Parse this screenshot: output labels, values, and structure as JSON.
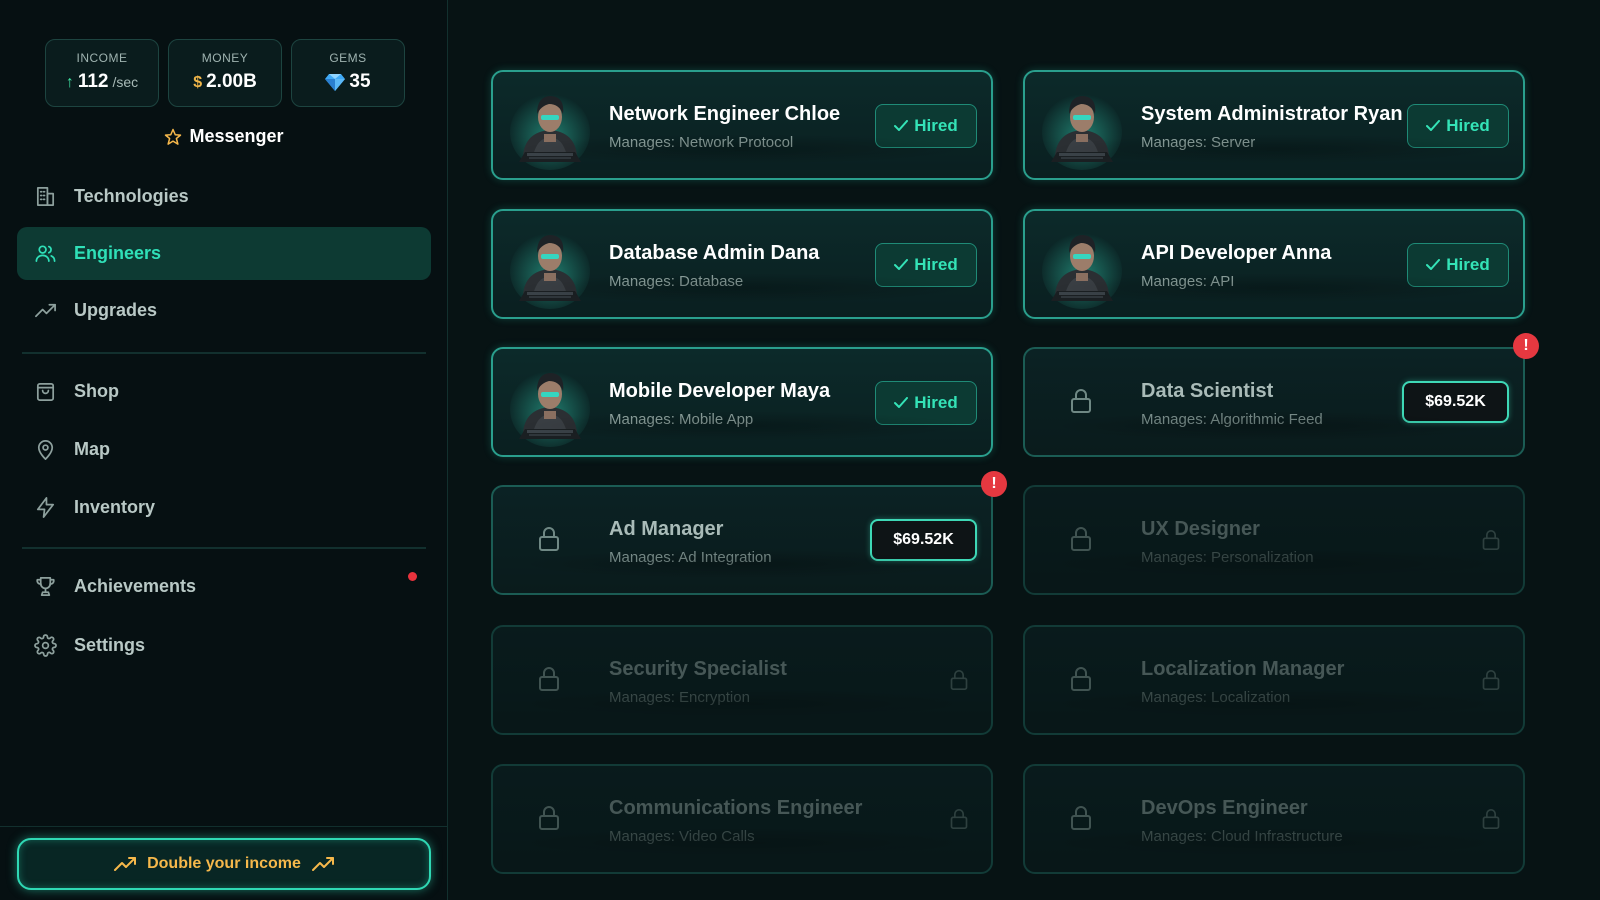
{
  "stats": {
    "income": {
      "label": "INCOME",
      "value": "112",
      "unit": "/sec"
    },
    "money": {
      "label": "MONEY",
      "symbol": "$",
      "value": "2.00B"
    },
    "gems": {
      "label": "GEMS",
      "value": "35"
    }
  },
  "rank": {
    "label": "Messenger",
    "icon": "star-icon"
  },
  "nav": {
    "technologies": "Technologies",
    "engineers": "Engineers",
    "upgrades": "Upgrades",
    "shop": "Shop",
    "map": "Map",
    "inventory": "Inventory",
    "achievements": "Achievements",
    "settings": "Settings"
  },
  "double_income": "Double your income",
  "hired_label": "Hired",
  "alert_mark": "!",
  "colors": {
    "accent": "#2fe0b8",
    "gold": "#f6b84b",
    "alert": "#e53840"
  },
  "engineers": [
    {
      "name": "Network Engineer Chloe",
      "manages": "Manages: Network Protocol",
      "status": "hired"
    },
    {
      "name": "System Administrator Ryan",
      "manages": "Manages: Server",
      "status": "hired"
    },
    {
      "name": "Database Admin Dana",
      "manages": "Manages: Database",
      "status": "hired"
    },
    {
      "name": "API Developer Anna",
      "manages": "Manages: API",
      "status": "hired"
    },
    {
      "name": "Mobile Developer Maya",
      "manages": "Manages: Mobile App",
      "status": "hired"
    },
    {
      "name": "Data Scientist",
      "manages": "Manages: Algorithmic Feed",
      "status": "available",
      "price": "$69.52K"
    },
    {
      "name": "Ad Manager",
      "manages": "Manages: Ad Integration",
      "status": "available",
      "price": "$69.52K"
    },
    {
      "name": "UX Designer",
      "manages": "Manages: Personalization",
      "status": "locked"
    },
    {
      "name": "Security Specialist",
      "manages": "Manages: Encryption",
      "status": "locked"
    },
    {
      "name": "Localization Manager",
      "manages": "Manages: Localization",
      "status": "locked"
    },
    {
      "name": "Communications Engineer",
      "manages": "Manages: Video Calls",
      "status": "locked"
    },
    {
      "name": "DevOps Engineer",
      "manages": "Manages: Cloud Infrastructure",
      "status": "locked"
    }
  ]
}
